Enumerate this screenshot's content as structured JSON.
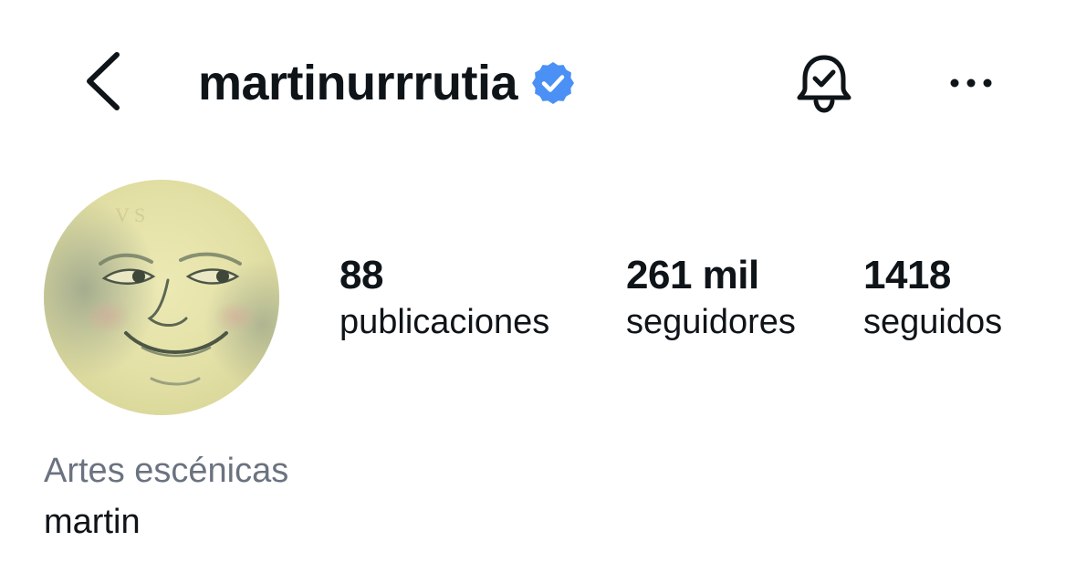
{
  "header": {
    "back_icon": "chevron-left-icon",
    "username": "martinurrrutia",
    "verified_icon": "verified-badge-icon",
    "verified_color": "#4a90f5",
    "notification_icon": "bell-check-icon",
    "more_icon": "more-horizontal-icon"
  },
  "profile": {
    "avatar_icon": "moon-face-avatar",
    "stats": [
      {
        "value": "88",
        "label": "publicaciones"
      },
      {
        "value": "261 mil",
        "label": "seguidores"
      },
      {
        "value": "1418",
        "label": "seguidos"
      }
    ],
    "category": "Artes escénicas",
    "name": "martin"
  },
  "colors": {
    "text": "#0f1419",
    "muted": "#6b7280",
    "background": "#ffffff",
    "accent": "#4a90f5"
  }
}
